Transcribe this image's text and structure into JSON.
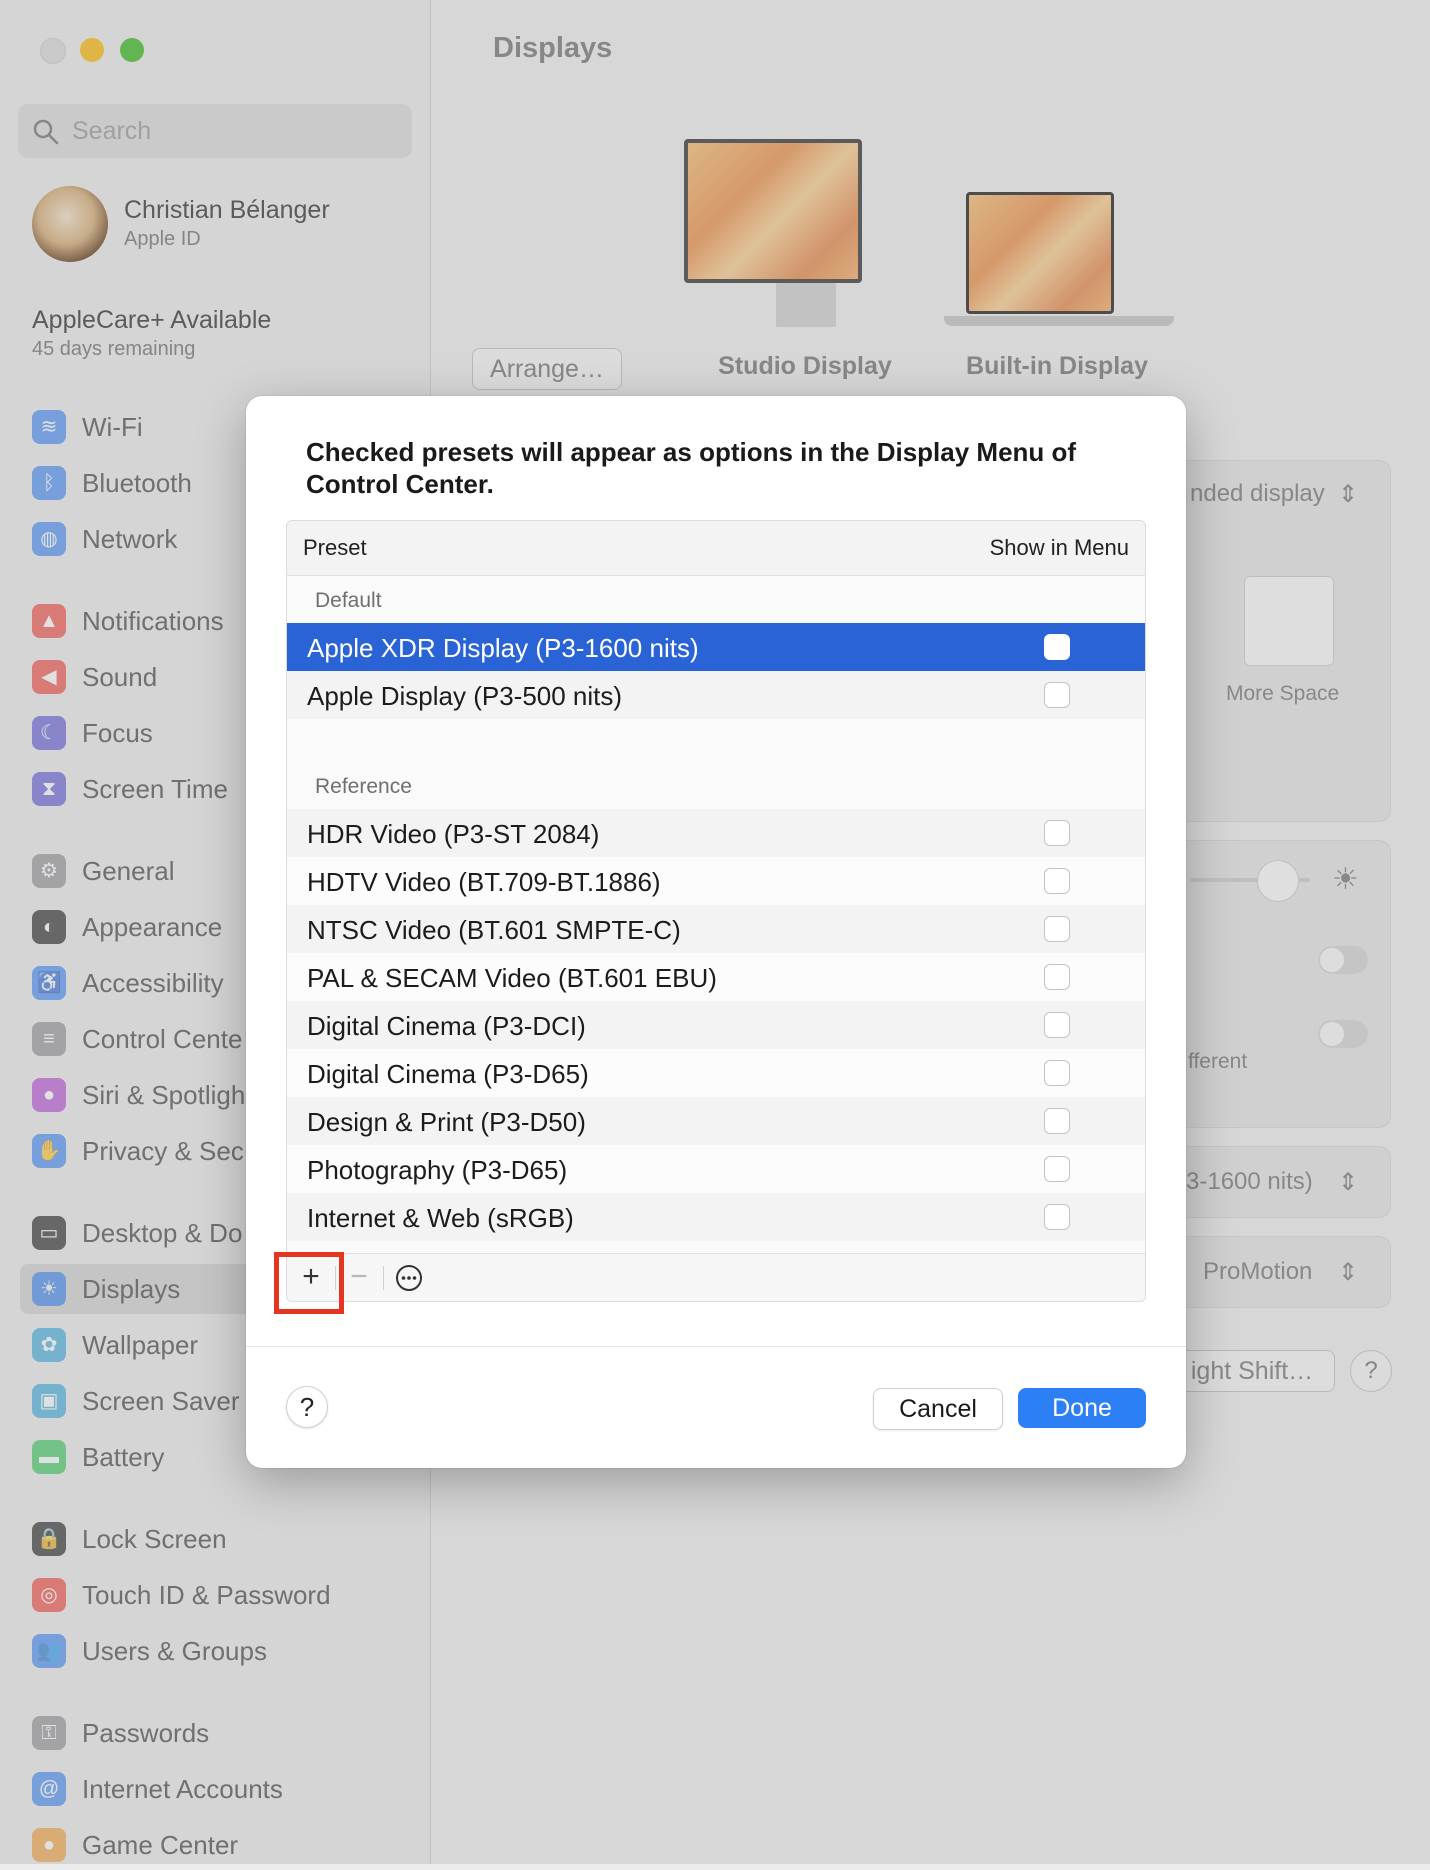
{
  "sidebar": {
    "search_placeholder": "Search",
    "user": {
      "name": "Christian Bélanger",
      "subtitle": "Apple ID"
    },
    "applecare": {
      "title": "AppleCare+ Available",
      "subtitle": "45 days remaining"
    },
    "items": [
      {
        "label": "Wi-Fi",
        "icon": "wifi-icon",
        "color": "#3a86f7"
      },
      {
        "label": "Bluetooth",
        "icon": "bluetooth-icon",
        "color": "#3a86f7"
      },
      {
        "label": "Network",
        "icon": "globe-icon",
        "color": "#3a86f7"
      },
      {
        "label": "Notifications",
        "icon": "bell-icon",
        "color": "#f0433a"
      },
      {
        "label": "Sound",
        "icon": "speaker-icon",
        "color": "#f0433a"
      },
      {
        "label": "Focus",
        "icon": "moon-icon",
        "color": "#5a55d6"
      },
      {
        "label": "Screen Time",
        "icon": "hourglass-icon",
        "color": "#5a55d6"
      },
      {
        "label": "General",
        "icon": "gear-icon",
        "color": "#8e8e93"
      },
      {
        "label": "Appearance",
        "icon": "appearance-icon",
        "color": "#1c1c1e"
      },
      {
        "label": "Accessibility",
        "icon": "accessibility-icon",
        "color": "#3a86f7"
      },
      {
        "label": "Control Cente",
        "icon": "toggles-icon",
        "color": "#8e8e93"
      },
      {
        "label": "Siri & Spotligh",
        "icon": "siri-icon",
        "color": "#b447d6"
      },
      {
        "label": "Privacy & Sec",
        "icon": "hand-icon",
        "color": "#3a86f7"
      },
      {
        "label": "Desktop & Do",
        "icon": "dock-icon",
        "color": "#1c1c1e"
      },
      {
        "label": "Displays",
        "icon": "sun-icon",
        "color": "#3a86f7"
      },
      {
        "label": "Wallpaper",
        "icon": "flower-icon",
        "color": "#35aadc"
      },
      {
        "label": "Screen Saver",
        "icon": "screensaver-icon",
        "color": "#35aadc"
      },
      {
        "label": "Battery",
        "icon": "battery-icon",
        "color": "#34c759"
      },
      {
        "label": "Lock Screen",
        "icon": "lock-icon",
        "color": "#1c1c1e"
      },
      {
        "label": "Touch ID & Password",
        "icon": "fingerprint-icon",
        "color": "#f0433a"
      },
      {
        "label": "Users & Groups",
        "icon": "users-icon",
        "color": "#3a86f7"
      },
      {
        "label": "Passwords",
        "icon": "key-icon",
        "color": "#8e8e93"
      },
      {
        "label": "Internet Accounts",
        "icon": "at-icon",
        "color": "#3a86f7"
      },
      {
        "label": "Game Center",
        "icon": "gamecenter-icon",
        "color": "#f29d38"
      }
    ]
  },
  "main": {
    "title": "Displays",
    "arrange_button": "Arrange…",
    "displays": [
      {
        "label": "Studio Display"
      },
      {
        "label": "Built-in Display"
      }
    ],
    "use_as_value": "nded display",
    "more_space_label": "More Space",
    "different_text": "fferent",
    "preset_value": "3-1600 nits)",
    "refresh_value": "ProMotion",
    "night_shift_button": "ight Shift…",
    "help": "?"
  },
  "modal": {
    "title": "Checked presets will appear as options in the Display Menu of Control Center.",
    "columns": {
      "preset": "Preset",
      "show": "Show in Menu"
    },
    "groups": [
      {
        "name": "Default",
        "rows": [
          {
            "label": "Apple XDR Display (P3-1600 nits)",
            "checked": false,
            "selected": true
          },
          {
            "label": "Apple Display (P3-500 nits)",
            "checked": false,
            "selected": false
          }
        ]
      },
      {
        "name": "Reference",
        "rows": [
          {
            "label": "HDR Video (P3-ST 2084)",
            "checked": false
          },
          {
            "label": "HDTV Video (BT.709-BT.1886)",
            "checked": false
          },
          {
            "label": "NTSC Video (BT.601 SMPTE-C)",
            "checked": false
          },
          {
            "label": "PAL & SECAM Video (BT.601 EBU)",
            "checked": false
          },
          {
            "label": "Digital Cinema (P3-DCI)",
            "checked": false
          },
          {
            "label": "Digital Cinema (P3-D65)",
            "checked": false
          },
          {
            "label": "Design & Print (P3-D50)",
            "checked": false
          },
          {
            "label": "Photography (P3-D65)",
            "checked": false
          },
          {
            "label": "Internet & Web (sRGB)",
            "checked": false
          }
        ]
      }
    ],
    "toolbar": {
      "add": "+",
      "remove": "−",
      "more": "⋯"
    },
    "help": "?",
    "cancel": "Cancel",
    "done": "Done"
  }
}
